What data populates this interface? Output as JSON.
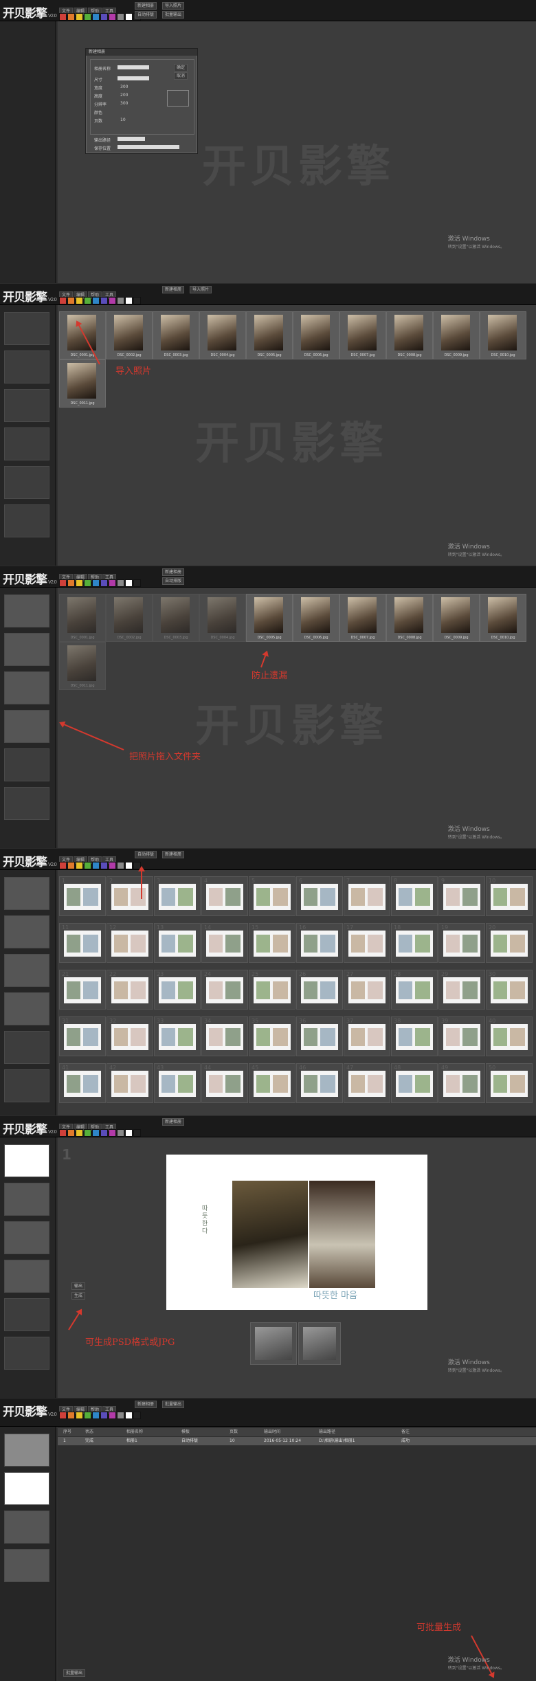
{
  "app": {
    "logo": "开贝影擎",
    "version": "V2.0",
    "menu": [
      "文件",
      "编辑",
      "帮助",
      "工具"
    ],
    "buttons": {
      "import_photos": "导入照片",
      "auto_layout": "自动排版",
      "batch_output": "批量输出",
      "new_album": "新建相册"
    },
    "swatch_colors": [
      "#d0403a",
      "#e07a2c",
      "#e6c229",
      "#56b03a",
      "#2e86c8",
      "#5a4dbb",
      "#b23aa8",
      "#888888",
      "#ffffff",
      "#222222"
    ]
  },
  "watermark": "开贝影擎",
  "win_activate": {
    "title": "激活 Windows",
    "sub": "转到\"设置\"以激活 Windows。"
  },
  "panel1": {
    "dialog": {
      "title": "新建相册",
      "labels": [
        "相册名称",
        "尺寸",
        "宽度",
        "高度",
        "分辨率",
        "颜色",
        "页数",
        "输出路径",
        "保存位置"
      ],
      "values": [
        "",
        "",
        "300",
        "200",
        "300",
        "",
        "10",
        "",
        ""
      ],
      "ok": "确定",
      "cancel": "取消"
    }
  },
  "panel2": {
    "photos": [
      "DSC_0001.jpg",
      "DSC_0002.jpg",
      "DSC_0003.jpg",
      "DSC_0004.jpg",
      "DSC_0005.jpg",
      "DSC_0006.jpg",
      "DSC_0007.jpg",
      "DSC_0008.jpg",
      "DSC_0009.jpg",
      "DSC_0010.jpg",
      "DSC_0011.jpg"
    ],
    "annotation": "导入照片"
  },
  "panel3": {
    "annotation_top": "防止遗漏",
    "annotation_left": "把照片拖入文件夹"
  },
  "panel4": {
    "page_numbers": [
      "1",
      "2",
      "3",
      "4",
      "5",
      "6",
      "7",
      "8",
      "9",
      "10",
      "11",
      "12",
      "13",
      "14",
      "15",
      "16",
      "17",
      "18",
      "19",
      "20",
      "21",
      "22",
      "23",
      "24",
      "25",
      "26",
      "27",
      "28",
      "29",
      "30",
      "31",
      "32",
      "33",
      "34",
      "35",
      "36",
      "37",
      "38",
      "39",
      "40",
      "41",
      "42",
      "43",
      "44",
      "45",
      "46",
      "47",
      "48",
      "49",
      "50"
    ]
  },
  "panel5": {
    "page_no": "1",
    "korean_title": "따뜻한 마음",
    "vertical_text": "따듯한다",
    "annotation": "可生成PSD格式或JPG",
    "output_label": "输出",
    "output_btn": "生成"
  },
  "panel6": {
    "headers": [
      "序号",
      "状态",
      "相册名称",
      "模板",
      "页数",
      "输出时间",
      "输出路径",
      "备注"
    ],
    "row": [
      "1",
      "完成",
      "相册1",
      "自动排版",
      "10",
      "2016-05-12 10:24",
      "D:\\相册\\输出\\相册1",
      "成功"
    ],
    "annotation": "可批量生成",
    "footer_btn": "批量输出"
  }
}
